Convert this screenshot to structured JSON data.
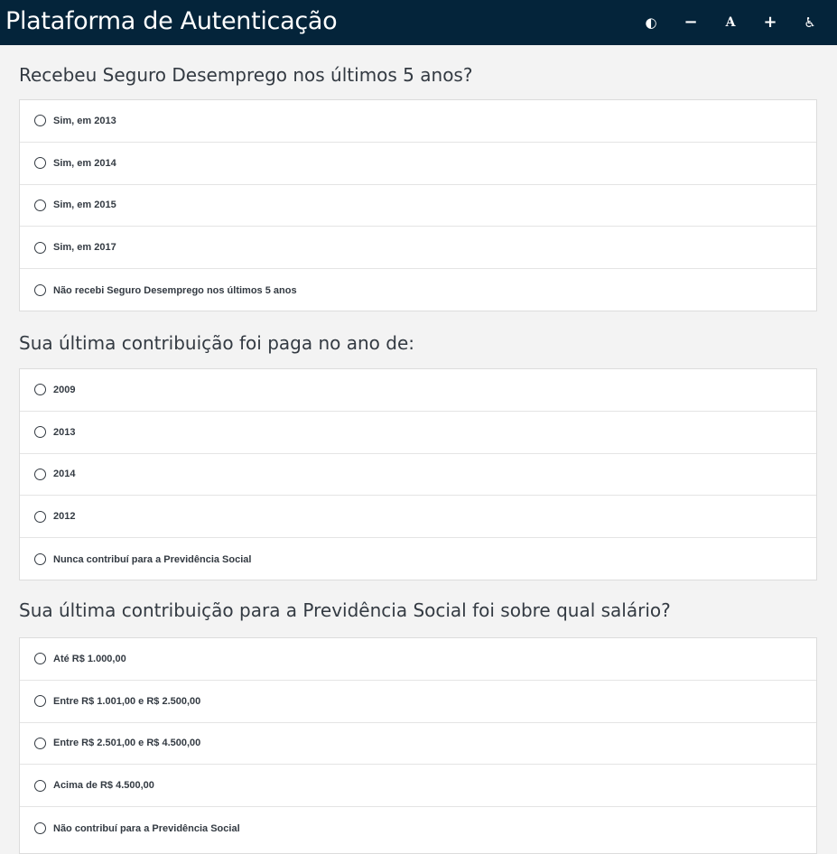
{
  "header": {
    "title": "Plataforma de Autenticação",
    "toolbar": [
      {
        "name": "contrast-button",
        "icon": "contrast-icon",
        "glyph": "◐"
      },
      {
        "name": "decrease-font-button",
        "icon": "minus-icon",
        "glyph": "−"
      },
      {
        "name": "default-font-button",
        "icon": "font-icon",
        "glyph": "A"
      },
      {
        "name": "increase-font-button",
        "icon": "plus-icon",
        "glyph": "+"
      },
      {
        "name": "accessibility-button",
        "icon": "wheelchair-icon",
        "glyph": "♿"
      }
    ]
  },
  "questions": [
    {
      "title": "Recebeu Seguro Desemprego nos últimos 5 anos?",
      "options": [
        "Sim, em 2013",
        "Sim, em 2014",
        "Sim, em 2015",
        "Sim, em 2017",
        "Não recebi Seguro Desemprego nos últimos 5 anos"
      ]
    },
    {
      "title": "Sua última contribuição foi paga no ano de:",
      "options": [
        "2009",
        "2013",
        "2014",
        "2012",
        "Nunca contribuí para a Previdência Social"
      ]
    },
    {
      "title": "Sua última contribuição para a Previdência Social foi sobre qual salário?",
      "options": [
        "Até R$ 1.000,00",
        "Entre R$ 1.001,00 e R$ 2.500,00",
        "Entre R$ 2.501,00 e R$ 4.500,00",
        "Acima de R$ 4.500,00",
        "Não contribuí para a Previdência Social"
      ]
    }
  ],
  "colors": {
    "header_bg": "#04243a",
    "page_bg": "#f3f3f3",
    "text": "#333a42"
  }
}
